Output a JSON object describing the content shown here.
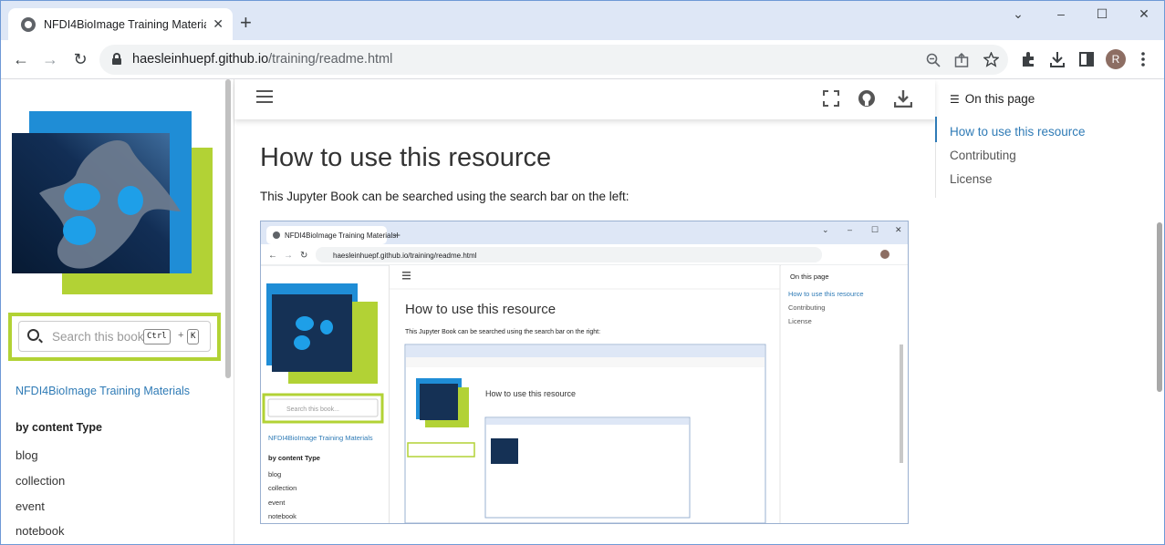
{
  "browser": {
    "tab_title": "NFDI4BioImage Training Materia",
    "tab_close": "✕",
    "new_tab": "+",
    "url_host": "haesleinhuepf.github.io",
    "url_path": "/training/readme.html",
    "avatar_letter": "R",
    "controls": {
      "minimize": "–",
      "maximize": "☐",
      "close": "✕",
      "chevron": "⌄"
    },
    "nav": {
      "back": "←",
      "forward": "→",
      "reload": "↻"
    }
  },
  "sidebar": {
    "search_placeholder": "Search this book...",
    "kbd_ctrl": "Ctrl",
    "kbd_plus": "+",
    "kbd_k": "K",
    "brand": "NFDI4BioImage Training Materials",
    "caption": "by content Type",
    "items": [
      "blog",
      "collection",
      "event",
      "notebook"
    ]
  },
  "main": {
    "title": "How to use this resource",
    "paragraph": "This Jupyter Book can be searched using the search bar on the left:"
  },
  "screenshot": {
    "tab_title": "NFDI4BioImage Training Materials",
    "url": "haesleinhuepf.github.io/training/readme.html",
    "title": "How to use this resource",
    "paragraph": "This Jupyter Book can be searched using the search bar on the right:",
    "search_placeholder": "Search this book...",
    "brand": "NFDI4BioImage Training Materials",
    "caption": "by content Type",
    "items": [
      "blog",
      "collection",
      "event",
      "notebook"
    ],
    "toc_head": "On this page",
    "toc": [
      "How to use this resource",
      "Contributing",
      "License"
    ]
  },
  "toc": {
    "heading": "On this page",
    "links": [
      "How to use this resource",
      "Contributing",
      "License"
    ]
  },
  "colors": {
    "accent": "#2f7bb6",
    "lime": "#b2d235",
    "blue": "#1f8dd6",
    "dark": "#0e2340"
  }
}
